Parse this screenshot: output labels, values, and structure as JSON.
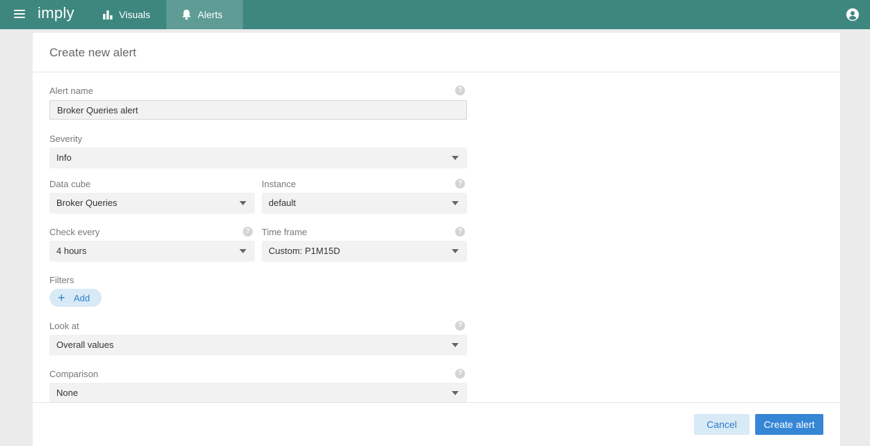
{
  "topbar": {
    "logo": "imply",
    "tabs": [
      {
        "label": "Visuals",
        "icon": "bar-chart-icon"
      },
      {
        "label": "Alerts",
        "icon": "bell-icon",
        "active": true
      }
    ],
    "user_icon": "user-circle-icon"
  },
  "panel": {
    "title": "Create new alert",
    "fields": {
      "alert_name": {
        "label": "Alert name",
        "value": "Broker Queries alert"
      },
      "severity": {
        "label": "Severity",
        "value": "Info"
      },
      "data_cube": {
        "label": "Data cube",
        "value": "Broker Queries"
      },
      "instance": {
        "label": "Instance",
        "value": "default"
      },
      "check_every": {
        "label": "Check every",
        "value": "4 hours"
      },
      "time_frame": {
        "label": "Time frame",
        "value": "Custom: P1M15D"
      },
      "filters": {
        "label": "Filters",
        "add_label": "Add"
      },
      "look_at": {
        "label": "Look at",
        "value": "Overall values"
      },
      "comparison": {
        "label": "Comparison",
        "value": "None"
      }
    },
    "help_glyph": "?",
    "footer": {
      "cancel_label": "Cancel",
      "create_label": "Create alert"
    }
  },
  "colors": {
    "topbar": "#3e877f",
    "active_tab": "#5e9c95",
    "primary_button": "#3686d6",
    "secondary_button": "#d9eaf7"
  }
}
